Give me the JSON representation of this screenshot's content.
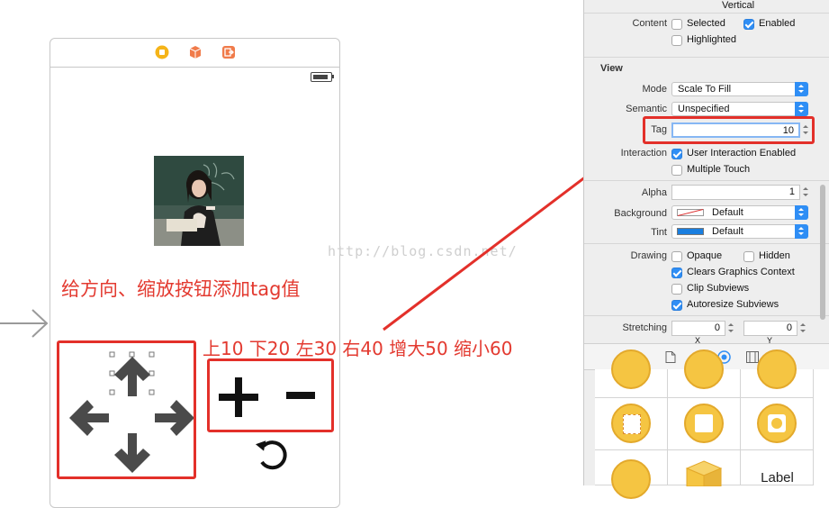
{
  "canvas": {
    "annotation_text": "给方向、缩放按钮添加tag值",
    "tag_values_text": "上10 下20 左30 右40 增大50 缩小60",
    "watermark": "http://blog.csdn.net/",
    "plus_symbol": "+",
    "minus_symbol": "−"
  },
  "inspector": {
    "vertical_label": "Vertical",
    "content_label": "Content",
    "selected_label": "Selected",
    "enabled_label": "Enabled",
    "highlighted_label": "Highlighted",
    "view_section_title": "View",
    "mode_label": "Mode",
    "mode_value": "Scale To Fill",
    "semantic_label": "Semantic",
    "semantic_value": "Unspecified",
    "tag_label": "Tag",
    "tag_value": "10",
    "interaction_label": "Interaction",
    "user_interaction_label": "User Interaction Enabled",
    "multiple_touch_label": "Multiple Touch",
    "alpha_label": "Alpha",
    "alpha_value": "1",
    "background_label": "Background",
    "background_value": "Default",
    "tint_label": "Tint",
    "tint_value": "Default",
    "drawing_label": "Drawing",
    "opaque_label": "Opaque",
    "hidden_label": "Hidden",
    "clears_label": "Clears Graphics Context",
    "clip_label": "Clip Subviews",
    "autoresize_label": "Autoresize Subviews",
    "stretching_label": "Stretching",
    "stretch_x_value": "0",
    "stretch_y_value": "0",
    "x_label": "X",
    "y_label": "Y",
    "library_label_text": "Label",
    "checkbox_states": {
      "selected": false,
      "enabled": true,
      "highlighted": false,
      "user_interaction": true,
      "multiple_touch": false,
      "opaque": false,
      "hidden": false,
      "clears": true,
      "clip": false,
      "autoresize": true
    }
  },
  "colors": {
    "annotation_red": "#e33a30",
    "accent_blue": "#2f8ef5",
    "tint_swatch": "#1a7fe0",
    "library_yellow": "#f5c542"
  },
  "icons": [
    "right-arrow-icon",
    "view-controller-icon",
    "first-responder-icon",
    "exit-icon",
    "battery-icon",
    "arrow-up-icon",
    "arrow-down-icon",
    "arrow-left-icon",
    "arrow-right-icon",
    "rotate-icon",
    "file-icon",
    "braces-icon",
    "identity-icon",
    "library-icon"
  ]
}
